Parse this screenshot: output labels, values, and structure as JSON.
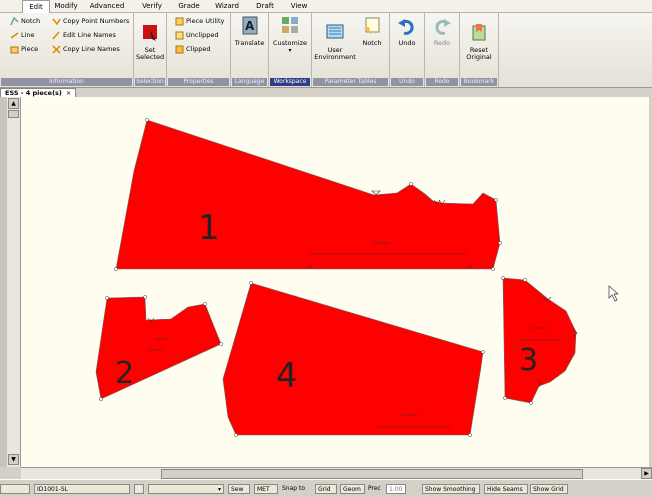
{
  "menu": [
    "Edit",
    "Modify",
    "Advanced",
    "Verify",
    "Grade",
    "Wizard",
    "Draft",
    "View"
  ],
  "ribbon": {
    "information": {
      "label": "Information",
      "items": [
        "Notch",
        "Copy Point Numbers",
        "Line",
        "Edit Line Names",
        "Piece",
        "Copy Line Names"
      ]
    },
    "selection": {
      "label": "Selection",
      "set_selected": "Set\nSelected"
    },
    "properties": {
      "label": "Properties",
      "items": [
        "Piece Utility",
        "Unclipped",
        "Clipped"
      ]
    },
    "language": {
      "label": "Language",
      "translate": "Translate"
    },
    "workspace": {
      "label": "Workspace",
      "customize": "Customize"
    },
    "parameter_tables": {
      "label": "Parameter Tables",
      "user_env": "User\nEnvironment",
      "notch": "Notch"
    },
    "undo": {
      "label": "Undo",
      "button": "Undo"
    },
    "redo": {
      "label": "Redo",
      "button": "Redo"
    },
    "bookmark": {
      "label": "Bookmark",
      "button": "Reset\nOriginal"
    }
  },
  "doc_tab": {
    "title": "ESS - 4 piece(s)",
    "close": "×"
  },
  "pieces": [
    {
      "number": "1",
      "color": "#ff0000"
    },
    {
      "number": "2",
      "color": "#ff0000"
    },
    {
      "number": "3",
      "color": "#ff0000"
    },
    {
      "number": "4",
      "color": "#ff0000"
    }
  ],
  "status": {
    "id": "ID1001-SL",
    "mode": "Sew",
    "units": "MET",
    "snap_label": "Snap to",
    "grid": "Grid",
    "geom": "Geom",
    "prec_label": "Prec",
    "prec_value": "1.00",
    "show_smoothing": "Show Smoothing",
    "hide_seams": "Hide Seams",
    "show_grid": "Show Grid"
  },
  "colors": {
    "piece_fill": "#ff0000",
    "canvas": "#fefdf0",
    "workspace_label": "#2e3d86"
  }
}
